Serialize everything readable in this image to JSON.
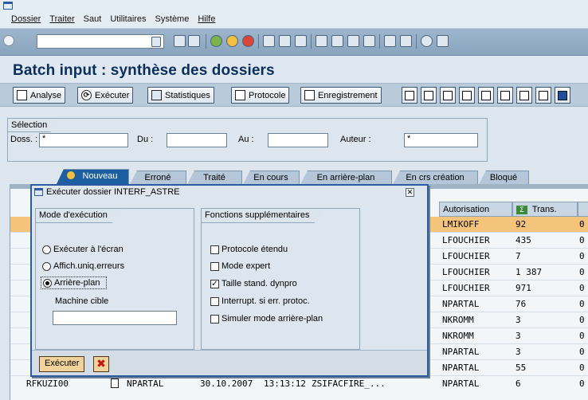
{
  "menu": {
    "items": [
      "Dossier",
      "Traiter",
      "Saut",
      "Utilitaires",
      "Système",
      "Hilfe"
    ]
  },
  "title": "Batch input : synthèse des dossiers",
  "app_toolbar": {
    "analyse": "Analyse",
    "executer": "Exécuter",
    "statistiques": "Statistiques",
    "protocole": "Protocole",
    "enregistrement": "Enregistrement"
  },
  "selection": {
    "group_title": "Sélection",
    "doss_label": "Doss. :",
    "doss_value": "*",
    "du_label": "Du :",
    "au_label": "Au :",
    "auteur_label": "Auteur :",
    "auteur_value": "*"
  },
  "tabs": [
    "Nouveau",
    "Erroné",
    "Traité",
    "En cours",
    "En arrière-plan",
    "En crs création",
    "Bloqué"
  ],
  "table": {
    "col_autorisation": "Autorisation",
    "col_trans": "Trans.",
    "rows": [
      {
        "auth": "LMIKOFF",
        "trans": "92",
        "last": "0"
      },
      {
        "auth": "LFOUCHIER",
        "trans": "435",
        "last": "0"
      },
      {
        "auth": "LFOUCHIER",
        "trans": "7",
        "last": "0"
      },
      {
        "auth": "LFOUCHIER",
        "trans": "1 387",
        "last": "0"
      },
      {
        "auth": "LFOUCHIER",
        "trans": "971",
        "last": "0"
      },
      {
        "auth": "NPARTAL",
        "trans": "76",
        "last": "0"
      },
      {
        "auth": "NKROMM",
        "trans": "3",
        "last": "0"
      },
      {
        "auth": "NKROMM",
        "trans": "3",
        "last": "0"
      },
      {
        "auth": "NPARTAL",
        "trans": "3",
        "last": "0"
      },
      {
        "auth": "NPARTAL",
        "trans": "55",
        "last": "0"
      },
      {
        "auth": "NPARTAL",
        "trans": "6",
        "last": "0"
      }
    ],
    "last_row": {
      "name": "RFKUZI00",
      "creator": "NPARTAL",
      "date": "30.10.2007",
      "time": "13:13:12",
      "dossier": "ZSIFACFIRE_..."
    }
  },
  "popup": {
    "title": "Exécuter dossier INTERF_ASTRE",
    "mode_title": "Mode d'exécution",
    "mode_options": [
      "Exécuter à l'écran",
      "Affich.uniq.erreurs",
      "Arrière-plan"
    ],
    "machine_label": "Machine cible",
    "fonctions_title": "Fonctions supplémentaires",
    "fonctions": [
      "Protocole étendu",
      "Mode expert",
      "Taille stand. dynpro",
      "Interrupt. si err. protoc.",
      "Simuler mode arrière-plan"
    ],
    "execute_btn": "Exécuter"
  }
}
